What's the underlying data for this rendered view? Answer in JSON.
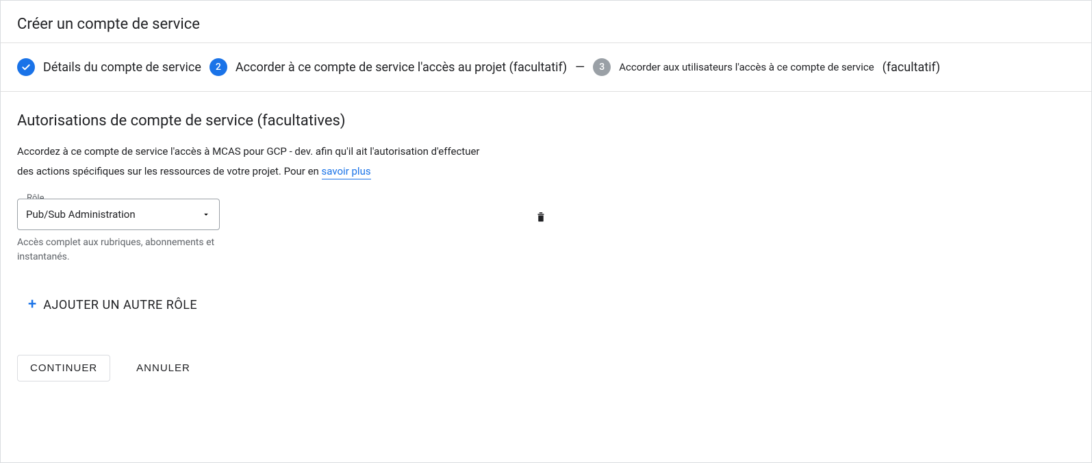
{
  "header": {
    "title": "Créer un compte de service"
  },
  "stepper": {
    "step1": {
      "label": "Détails du compte de service"
    },
    "step2": {
      "number": "2",
      "label": "Accorder à ce compte de service l'accès au projet (facultatif)"
    },
    "dash": "—",
    "step3": {
      "number": "3",
      "label": "Accorder aux utilisateurs l'accès à ce compte de service",
      "suffix": "(facultatif)"
    }
  },
  "section": {
    "title": "Autorisations de compte de service (facultatives)",
    "desc_prefix": "Accordez à ce compte de service l'accès à MCAS pour GCP - dev. afin qu'il ait l'autorisation d'effectuer des actions spécifiques sur les ressources de votre projet. Pour en ",
    "link": "savoir plus"
  },
  "role": {
    "field_label": "Rôle",
    "value": "Pub/Sub Administration",
    "helper": "Accès complet aux rubriques, abonnements et instantanés."
  },
  "add_role": {
    "label": "AJOUTER UN AUTRE RÔLE"
  },
  "actions": {
    "continue": "CONTINUER",
    "cancel": "ANNULER"
  }
}
